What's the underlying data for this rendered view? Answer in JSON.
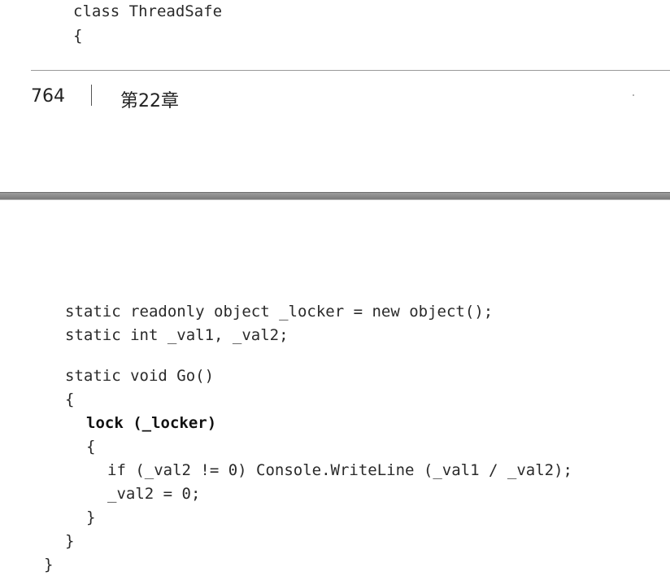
{
  "top_page": {
    "code": [
      "class ThreadSafe",
      "{"
    ],
    "page_number": "764",
    "chapter": "第22章"
  },
  "bottom_page": {
    "code": [
      "static readonly object _locker = new object();",
      "static int _val1, _val2;",
      "static void Go()",
      "{",
      "lock (_locker)",
      "{",
      "if (_val2 != 0) Console.WriteLine (_val1 / _val2);",
      "_val2 = 0;",
      "}",
      "}",
      "}"
    ]
  }
}
